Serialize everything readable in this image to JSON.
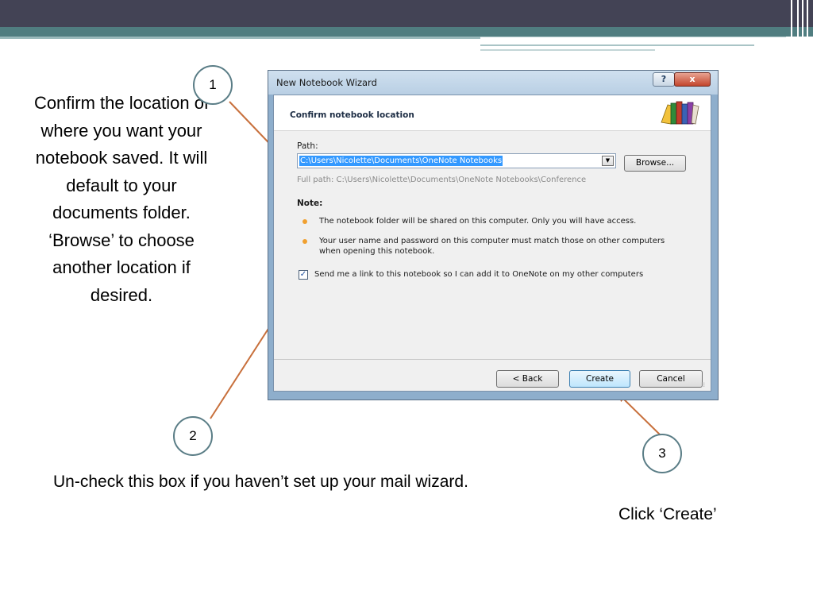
{
  "slide": {
    "left_text": "Confirm the location of where you want your notebook saved. It will default to your documents folder. ‘Browse’ to choose another location if desired.",
    "caption_2": "Un-check this box if you haven’t set up your mail wizard.",
    "caption_3": "Click ‘Create’",
    "steps": [
      "1",
      "2",
      "3"
    ],
    "arrow_color": "#c8703c"
  },
  "dialog": {
    "title": "New Notebook Wizard",
    "help_glyph": "?",
    "close_glyph": "x",
    "header_title": "Confirm notebook location",
    "path_label": "Path:",
    "path_value": "C:\\Users\\Nicolette\\Documents\\OneNote Notebooks",
    "browse_label": "Browse...",
    "full_path": "Full path: C:\\Users\\Nicolette\\Documents\\OneNote Notebooks\\Conference",
    "note_label": "Note:",
    "notes": [
      "The notebook folder will be shared on this computer. Only you will have access.",
      "Your user name and password on this computer must match those on other computers when opening this notebook."
    ],
    "checkbox_checked": true,
    "checkbox_label": "Send me a link to this notebook so I can add it to OneNote on my other computers",
    "back_label": "< Back",
    "create_label": "Create",
    "cancel_label": "Cancel"
  },
  "colors": {
    "header_dark": "#434355",
    "header_teal": "#507d80",
    "selection": "#3399ff",
    "bullet": "#f0a030"
  },
  "icons": [
    "books-icon",
    "help-icon",
    "close-icon",
    "dropdown-arrow-icon",
    "checkmark-icon",
    "resize-grip-icon"
  ]
}
